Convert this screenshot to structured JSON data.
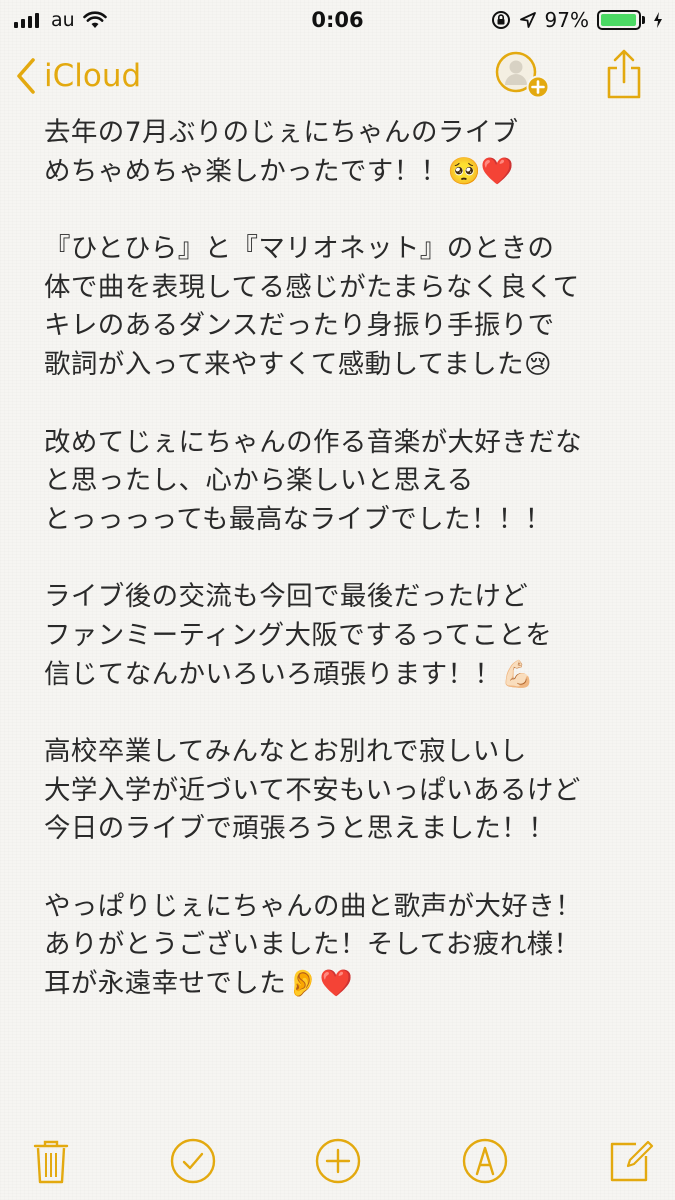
{
  "status_bar": {
    "carrier": "au",
    "time": "0:06",
    "battery_percent_label": "97%",
    "battery_level": 0.97,
    "battery_color": "#4cd964"
  },
  "nav": {
    "back_label": "iCloud",
    "accent_color": "#e3a90f",
    "icons": [
      "chevron-left-icon",
      "add-person-icon",
      "share-icon"
    ]
  },
  "note": {
    "lines": [
      "去年の7月ぶりのじぇにちゃんのライブ",
      "めちゃめちゃ楽しかったです！！🥺❤️",
      "",
      "『ひとひら』と『マリオネット』のときの",
      "体で曲を表現してる感じがたまらなく良くて",
      "キレのあるダンスだったり身振り手振りで",
      "歌詞が入って来やすくて感動してました😢",
      "",
      "改めてじぇにちゃんの作る音楽が大好きだな",
      "と思ったし、心から楽しいと思える",
      "とっっっっても最高なライブでした！！！",
      "",
      "ライブ後の交流も今回で最後だったけど",
      "ファンミーティング大阪でするってことを",
      "信じてなんかいろいろ頑張ります！！💪🏻",
      "",
      "高校卒業してみんなとお別れで寂しいし",
      "大学入学が近づいて不安もいっぱいあるけど",
      "今日のライブで頑張ろうと思えました！！",
      "",
      "やっぱりじぇにちゃんの曲と歌声が大好き！",
      "ありがとうございました！そしてお疲れ様！",
      "耳が永遠幸せでした👂❤️"
    ]
  },
  "toolbar": {
    "icons": [
      "trash-icon",
      "checklist-icon",
      "add-icon",
      "markup-icon",
      "compose-icon"
    ]
  }
}
